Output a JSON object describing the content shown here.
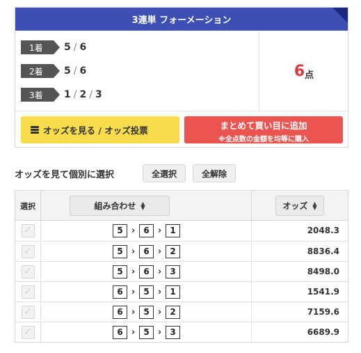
{
  "summary": {
    "title": "3連単 フォーメーション",
    "rows": [
      {
        "rank": "1着",
        "values": [
          "5",
          "6"
        ]
      },
      {
        "rank": "2着",
        "values": [
          "5",
          "6"
        ]
      },
      {
        "rank": "3着",
        "values": [
          "1",
          "2",
          "3"
        ]
      }
    ],
    "points_value": "6",
    "points_unit": "点",
    "odds_button_label": "オッズを見る / オッズ投票",
    "add_button_line1": "まとめて買い目に追加",
    "add_button_line2": "※全点数の金額を均等に購入"
  },
  "individual": {
    "title": "オッズを見て個別に選択",
    "select_all_label": "全選択",
    "clear_all_label": "全解除"
  },
  "table": {
    "col_select": "選択",
    "col_combo": "組み合わせ",
    "col_odds": "オッズ",
    "rows": [
      {
        "combo": [
          "5",
          "6",
          "1"
        ],
        "odds": "2048.3"
      },
      {
        "combo": [
          "5",
          "6",
          "2"
        ],
        "odds": "8836.4"
      },
      {
        "combo": [
          "5",
          "6",
          "3"
        ],
        "odds": "8498.0"
      },
      {
        "combo": [
          "6",
          "5",
          "1"
        ],
        "odds": "1541.9"
      },
      {
        "combo": [
          "6",
          "5",
          "2"
        ],
        "odds": "7159.6"
      },
      {
        "combo": [
          "6",
          "5",
          "3"
        ],
        "odds": "6689.9"
      }
    ]
  },
  "icons": {
    "sort": "sort-icon",
    "coin_stack": "coin-stack-icon",
    "check": "check-icon",
    "arrow": "chevron-right-icon"
  },
  "colors": {
    "header_bg": "#3d4fb4",
    "points": "#e0393b",
    "odds_button": "#f7dc4b",
    "add_button": "#ec5450"
  }
}
